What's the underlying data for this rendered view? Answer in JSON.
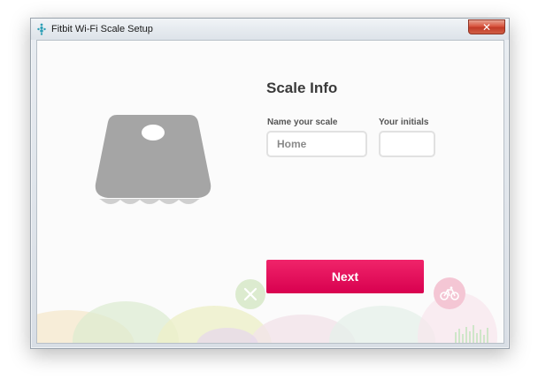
{
  "window": {
    "title": "Fitbit Wi-Fi Scale Setup",
    "close_glyph": "✕"
  },
  "form": {
    "heading": "Scale Info",
    "name_label": "Name your scale",
    "name_placeholder": "Home",
    "initials_label": "Your initials",
    "initials_value": ""
  },
  "actions": {
    "next_label": "Next"
  },
  "colors": {
    "accent": "#e8005a",
    "scale_gray": "#a5a5a5"
  },
  "icons": {
    "app": "fitbit-logo-icon",
    "food": "fork-knife-icon",
    "activity": "bicycle-icon"
  }
}
